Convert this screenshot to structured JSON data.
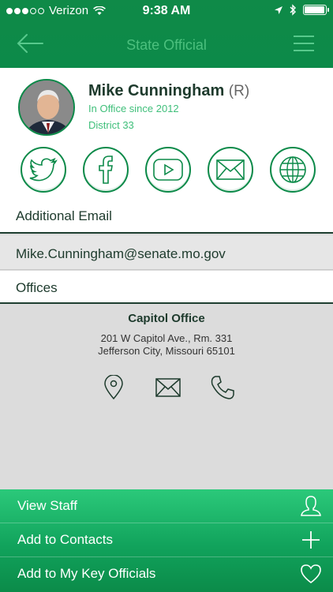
{
  "status_bar": {
    "carrier": "Verizon",
    "time": "9:38 AM",
    "battery_level": 0.9
  },
  "nav": {
    "title": "State Official"
  },
  "official": {
    "name": "Mike Cunningham",
    "party": "(R)",
    "since": "In Office since 2012",
    "district": "District 33"
  },
  "social_icons": [
    "twitter-icon",
    "facebook-icon",
    "youtube-icon",
    "mail-icon",
    "globe-icon"
  ],
  "sections": {
    "additional_email_label": "Additional Email",
    "email": "Mike.Cunningham@senate.mo.gov",
    "offices_label": "Offices"
  },
  "office": {
    "title": "Capitol Office",
    "address_line1": "201 W Capitol Ave., Rm. 331",
    "address_line2": "Jefferson City, Missouri  65101"
  },
  "actions": {
    "view_staff": "View Staff",
    "add_contacts": "Add to Contacts",
    "add_key_officials": "Add to My Key Officials"
  },
  "colors": {
    "brand_green": "#0c8a49",
    "light_green": "#3fbf7a",
    "dark_text": "#1d3a2c"
  }
}
